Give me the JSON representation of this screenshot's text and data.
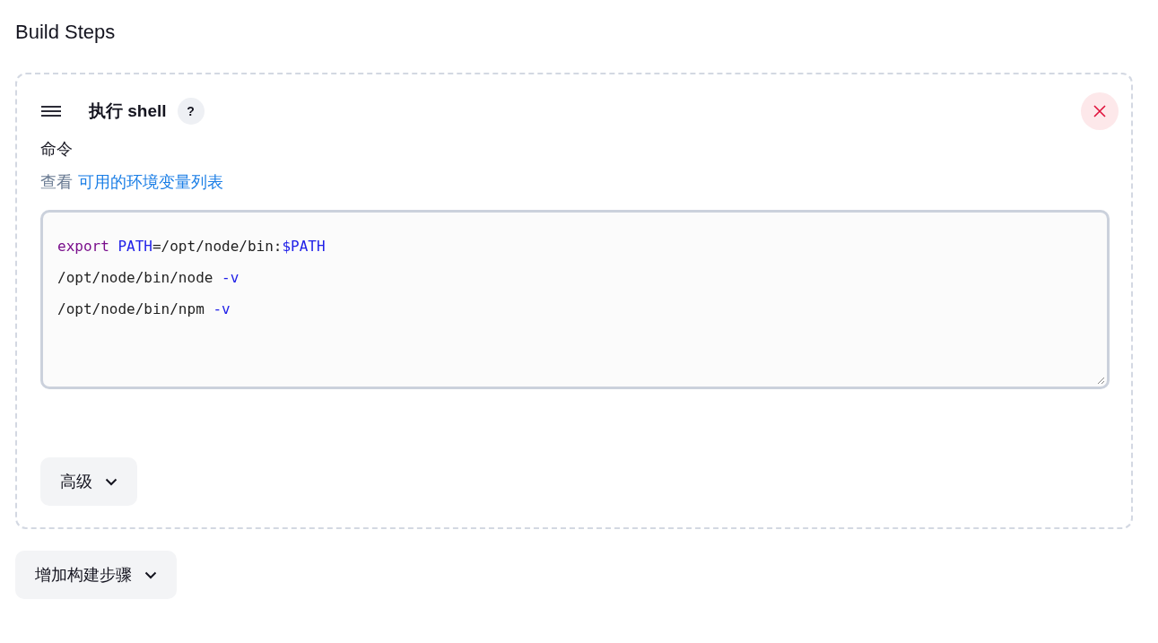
{
  "section_title": "Build Steps",
  "step": {
    "title": "执行 shell",
    "help": "?",
    "field_label": "命令",
    "env_hint": {
      "prefix": "查看",
      "link": "可用的环境变量列表"
    },
    "code_lines": [
      [
        {
          "kind": "keyword",
          "text": "export "
        },
        {
          "kind": "variable",
          "text": "PATH"
        },
        {
          "kind": "plain",
          "text": "=/opt/node/bin:"
        },
        {
          "kind": "variable",
          "text": "$PATH"
        }
      ],
      [
        {
          "kind": "plain",
          "text": "/opt/node/bin/node "
        },
        {
          "kind": "variable",
          "text": "-v"
        }
      ],
      [
        {
          "kind": "plain",
          "text": "/opt/node/bin/npm "
        },
        {
          "kind": "variable",
          "text": "-v"
        }
      ]
    ],
    "advanced_button": "高级"
  },
  "add_step_button": "增加构建步骤"
}
